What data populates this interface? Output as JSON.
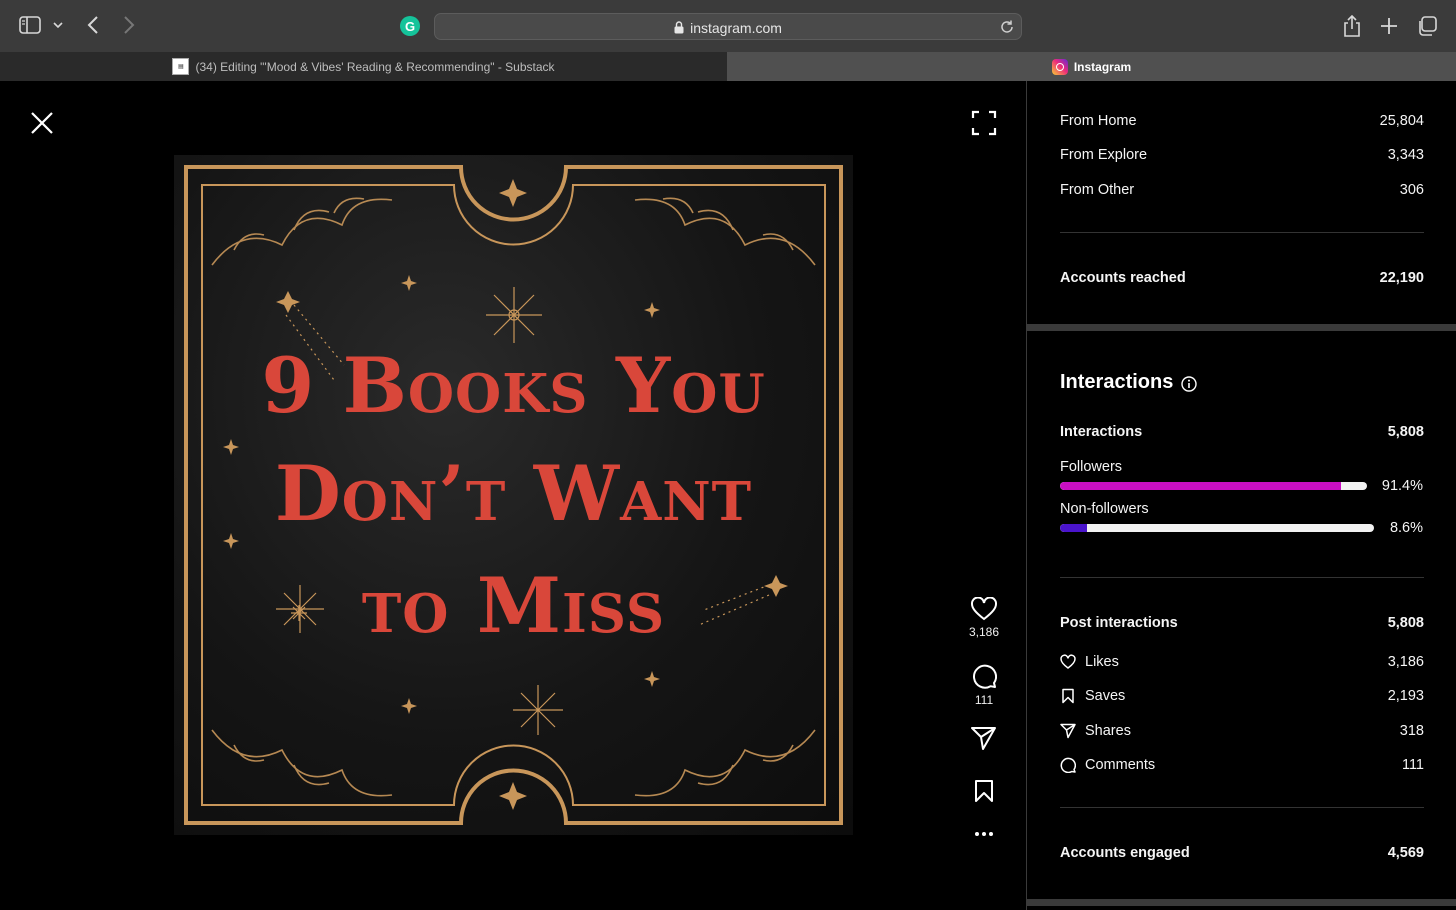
{
  "browser": {
    "url": "instagram.com",
    "tabs": [
      {
        "label": "(34) Editing \"'Mood & Vibes' Reading & Recommending\" - Substack",
        "active": false
      },
      {
        "label": "Instagram",
        "active": true
      }
    ],
    "grammarly_letter": "G",
    "icons": [
      "sidebar-icon",
      "chevron-down-icon",
      "back-icon",
      "forward-icon",
      "lock-icon",
      "reload-icon",
      "share-icon",
      "plus-icon",
      "tabs-icon"
    ]
  },
  "post": {
    "image_text": {
      "line1": "9 Books You",
      "line2": "Don’t Want",
      "line3": "to Miss"
    },
    "colors": {
      "title": "#d9473a",
      "gold": "#c8965a"
    },
    "likes": "3,186",
    "comments": "111"
  },
  "insights": {
    "sources": [
      {
        "label": "From Home",
        "value": "25,804"
      },
      {
        "label": "From Explore",
        "value": "3,343"
      },
      {
        "label": "From Other",
        "value": "306"
      }
    ],
    "accounts_reached": {
      "label": "Accounts reached",
      "value": "22,190"
    },
    "interactions_title": "Interactions",
    "interactions_total": {
      "label": "Interactions",
      "value": "5,808"
    },
    "audience": [
      {
        "label": "Followers",
        "percent": "91.4%",
        "fraction": 0.914,
        "color": "#c90fc3"
      },
      {
        "label": "Non-followers",
        "percent": "8.6%",
        "fraction": 0.086,
        "color": "#4a14cc"
      }
    ],
    "post_interactions": {
      "label": "Post interactions",
      "value": "5,808"
    },
    "post_items": [
      {
        "label": "Likes",
        "value": "3,186",
        "icon": "heart-icon"
      },
      {
        "label": "Saves",
        "value": "2,193",
        "icon": "bookmark-icon"
      },
      {
        "label": "Shares",
        "value": "318",
        "icon": "send-icon"
      },
      {
        "label": "Comments",
        "value": "111",
        "icon": "comment-icon"
      }
    ],
    "accounts_engaged": {
      "label": "Accounts engaged",
      "value": "4,569"
    }
  }
}
